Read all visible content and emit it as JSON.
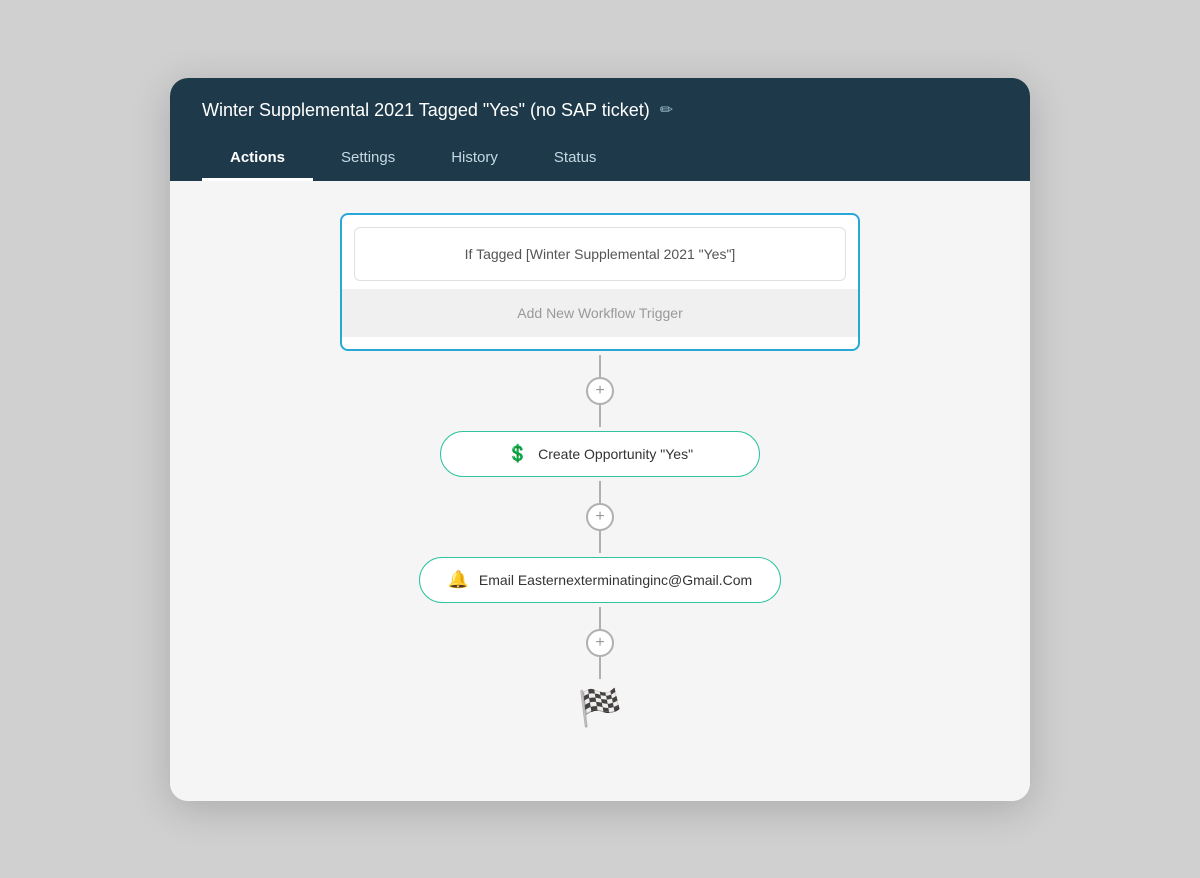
{
  "header": {
    "title": "Winter Supplemental 2021 Tagged \"Yes\" (no SAP ticket)",
    "edit_icon": "✏"
  },
  "tabs": [
    {
      "id": "actions",
      "label": "Actions",
      "active": true
    },
    {
      "id": "settings",
      "label": "Settings",
      "active": false
    },
    {
      "id": "history",
      "label": "History",
      "active": false
    },
    {
      "id": "status",
      "label": "Status",
      "active": false
    }
  ],
  "workflow": {
    "trigger_condition": "If Tagged [Winter Supplemental 2021 \"Yes\"]",
    "add_trigger_label": "Add New Workflow Trigger",
    "actions": [
      {
        "id": "create-opportunity",
        "icon": "💲",
        "icon_type": "opportunity",
        "label": "Create Opportunity \"Yes\""
      },
      {
        "id": "email-action",
        "icon": "🔔",
        "icon_type": "email",
        "label": "Email Easternexterminatinginc@Gmail.Com"
      }
    ],
    "finish_icon": "🏁"
  }
}
